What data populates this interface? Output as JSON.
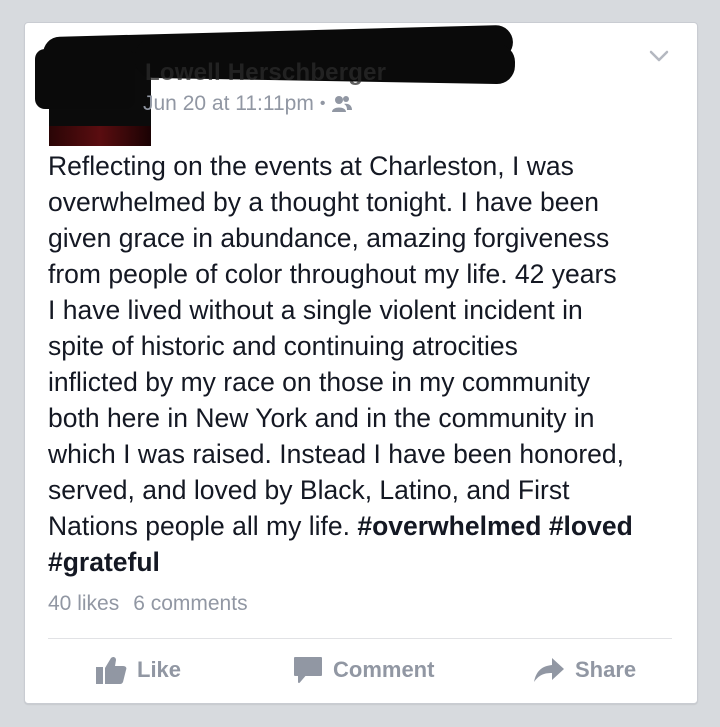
{
  "post": {
    "author": "Lowell Herschberger",
    "timestamp": "Jun 20 at 11:11pm",
    "separator": "•",
    "audience_icon": "friends-icon",
    "menu_icon": "chevron-down-icon",
    "text_lines": [
      "Reflecting on the events at Charleston, I was",
      "overwhelmed by a thought tonight. I have been",
      "given grace in abundance, amazing forgiveness",
      "from people of color throughout my life. 42 years",
      "I have lived without a single violent incident in",
      "spite of historic and continuing atrocities",
      "inflicted by my race on those in my community",
      "both here in New York and in the community in",
      "which I was raised. Instead I have been honored,",
      "served, and loved by Black, Latino, and First"
    ],
    "text_line_11_plain": "Nations people all my life.  ",
    "hashtags": [
      "#overwhelmed",
      "#loved",
      "#grateful"
    ]
  },
  "stats": {
    "likes": "40 likes",
    "comments": "6 comments"
  },
  "actions": {
    "like_label": "Like",
    "comment_label": "Comment",
    "share_label": "Share"
  },
  "colors": {
    "page_background": "#d7dade",
    "card_background": "#ffffff",
    "body_text": "#141823",
    "muted_text": "#9197a3"
  }
}
